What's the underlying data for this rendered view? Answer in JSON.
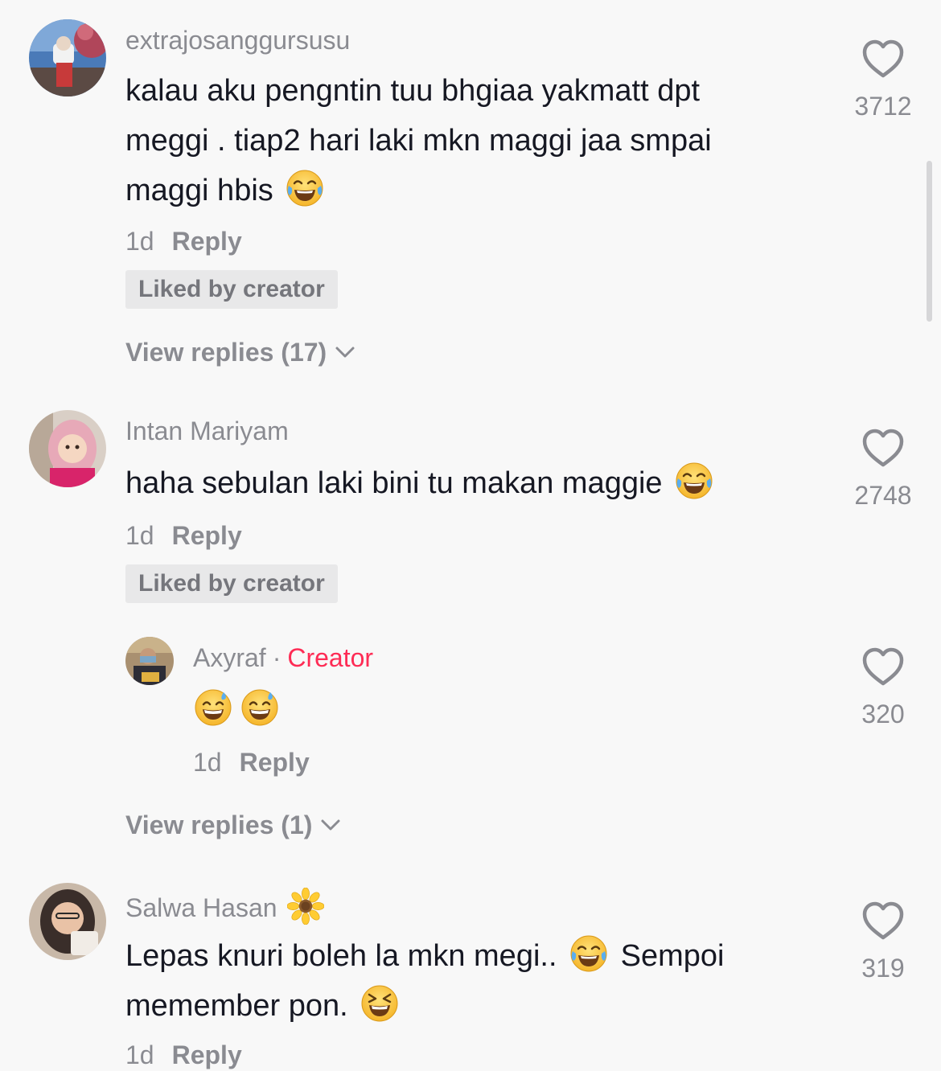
{
  "comments": [
    {
      "username": "extrajosanggursusu",
      "text_line1": "kalau aku pengntin tuu bhgiaa yakmatt dpt",
      "text_line2": "meggi . tiap2 hari laki mkn maggi jaa smpai",
      "text_line3": "maggi hbis",
      "emoji": "face-with-tears-of-joy",
      "time": "1d",
      "reply_label": "Reply",
      "liked_label": "Liked by creator",
      "view_replies": "View replies (17)",
      "likes": "3712"
    },
    {
      "username": "Intan Mariyam",
      "text": "haha sebulan laki bini tu makan maggie",
      "emoji": "face-with-tears-of-joy",
      "time": "1d",
      "reply_label": "Reply",
      "liked_label": "Liked by creator",
      "likes": "2748",
      "reply": {
        "username": "Axyraf",
        "separator": "·",
        "creator_label": "Creator",
        "emojis": [
          "grinning-face-with-sweat",
          "grinning-face-with-sweat"
        ],
        "time": "1d",
        "reply_label": "Reply",
        "likes": "320"
      },
      "view_replies": "View replies (1)"
    },
    {
      "username": "Salwa Hasan",
      "name_emoji": "sunflower",
      "text_part1": "Lepas knuri boleh la mkn megi..",
      "text_part2": "Sempoi",
      "text_line2": "memember pon.",
      "emojis": [
        "face-with-tears-of-joy",
        "grinning-squinting-face"
      ],
      "time": "1d",
      "reply_label": "Reply",
      "likes": "319"
    }
  ],
  "colors": {
    "background": "#f8f8f8",
    "text": "#161823",
    "secondary": "#8a8b91",
    "creator": "#fe2c55",
    "liked_bg": "#e8e8e9"
  }
}
